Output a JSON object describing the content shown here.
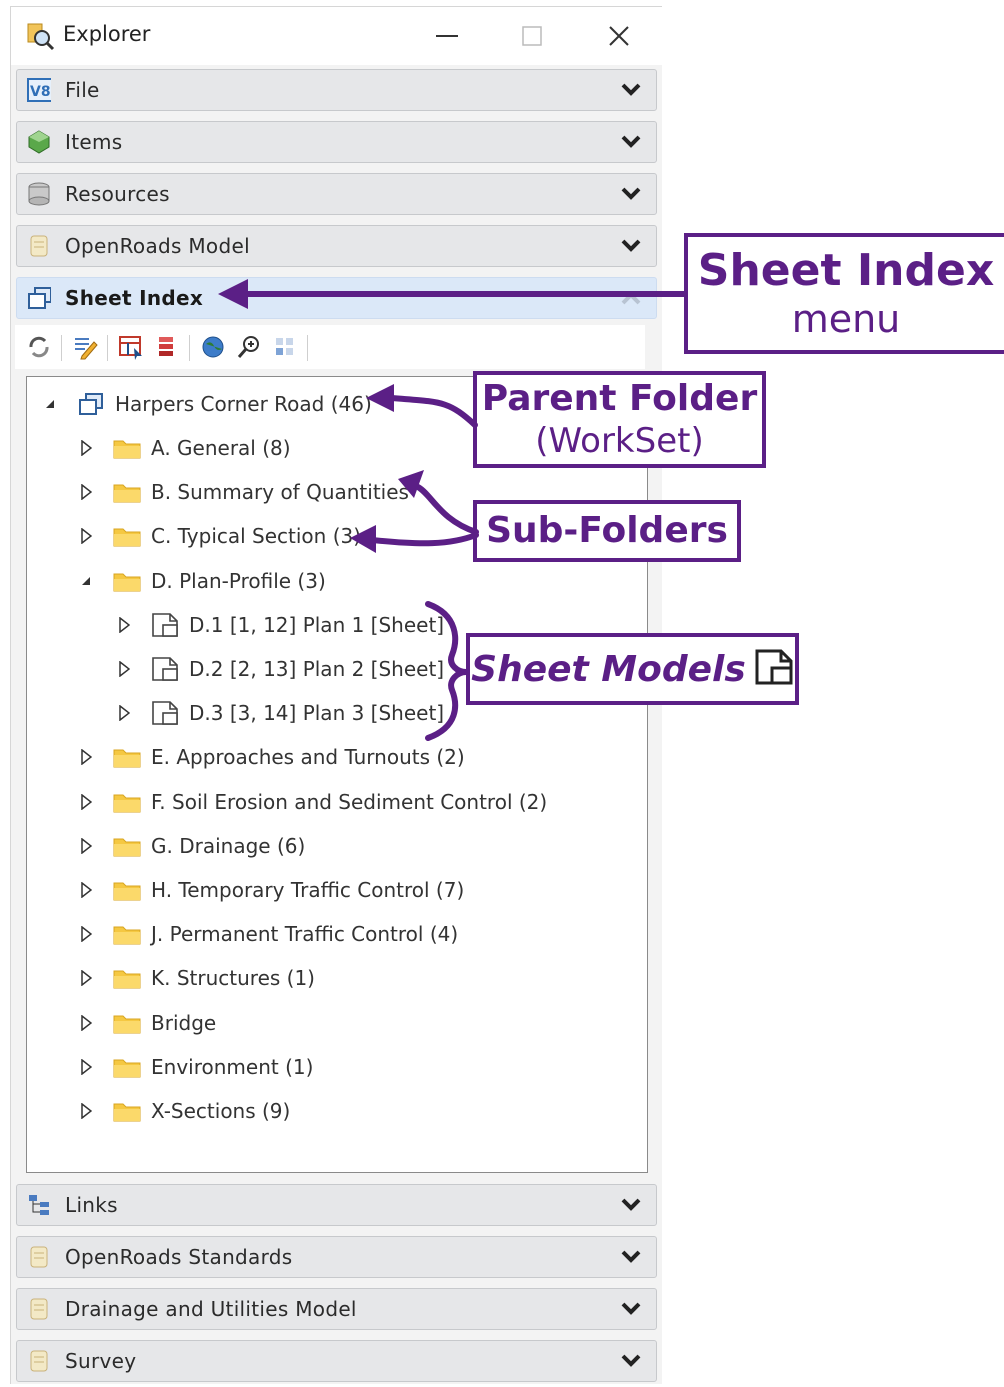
{
  "window": {
    "title": "Explorer",
    "minimize_glyph": "—",
    "maximize_glyph": "☐",
    "close_glyph": "✕"
  },
  "panels_top": [
    {
      "label": "File",
      "icon": "v8-file-icon"
    },
    {
      "label": "Items",
      "icon": "items-cube-icon"
    },
    {
      "label": "Resources",
      "icon": "resources-icon"
    },
    {
      "label": "OpenRoads Model",
      "icon": "document-cylinder-icon"
    }
  ],
  "sheet_index": {
    "label": "Sheet Index",
    "icon": "sheet-index-icon"
  },
  "toolbar": [
    "refresh-icon",
    "edit-properties-icon",
    "table-select-icon",
    "stack-icon",
    "globe-icon",
    "zoom-icon",
    "grid-icon"
  ],
  "tree": {
    "root": {
      "label": "Harpers Corner Road (46)",
      "expanded": true
    },
    "items": [
      {
        "label": "A. General (8)",
        "type": "folder",
        "level": 1,
        "expander": "collapsed"
      },
      {
        "label": "B. Summary of Quantities",
        "type": "folder",
        "level": 1,
        "expander": "collapsed"
      },
      {
        "label": "C. Typical Section (3)",
        "type": "folder",
        "level": 1,
        "expander": "collapsed"
      },
      {
        "label": "D. Plan-Profile (3)",
        "type": "folder",
        "level": 1,
        "expander": "expanded"
      },
      {
        "label": "D.1 [1, 12] Plan 1 [Sheet]",
        "type": "sheet",
        "level": 2,
        "expander": "collapsed"
      },
      {
        "label": "D.2 [2, 13] Plan 2 [Sheet]",
        "type": "sheet",
        "level": 2,
        "expander": "collapsed"
      },
      {
        "label": "D.3 [3, 14] Plan 3 [Sheet]",
        "type": "sheet",
        "level": 2,
        "expander": "collapsed"
      },
      {
        "label": "E. Approaches and Turnouts (2)",
        "type": "folder",
        "level": 1,
        "expander": "collapsed"
      },
      {
        "label": "F. Soil Erosion and Sediment Control (2)",
        "type": "folder",
        "level": 1,
        "expander": "collapsed"
      },
      {
        "label": "G. Drainage (6)",
        "type": "folder",
        "level": 1,
        "expander": "collapsed"
      },
      {
        "label": "H. Temporary Traffic Control (7)",
        "type": "folder",
        "level": 1,
        "expander": "collapsed"
      },
      {
        "label": "J. Permanent Traffic Control (4)",
        "type": "folder",
        "level": 1,
        "expander": "collapsed"
      },
      {
        "label": "K. Structures (1)",
        "type": "folder",
        "level": 1,
        "expander": "collapsed"
      },
      {
        "label": "Bridge",
        "type": "folder",
        "level": 1,
        "expander": "collapsed"
      },
      {
        "label": "Environment (1)",
        "type": "folder",
        "level": 1,
        "expander": "collapsed"
      },
      {
        "label": "X-Sections (9)",
        "type": "folder",
        "level": 1,
        "expander": "collapsed"
      }
    ]
  },
  "panels_bottom": [
    {
      "label": "Links",
      "icon": "links-tree-icon"
    },
    {
      "label": "OpenRoads Standards",
      "icon": "document-cylinder-icon"
    },
    {
      "label": "Drainage and Utilities Model",
      "icon": "document-cylinder-icon"
    },
    {
      "label": "Survey",
      "icon": "document-cylinder-icon"
    }
  ],
  "callouts": {
    "sheet_index_title": "Sheet Index",
    "sheet_index_sub": "menu",
    "parent_folder_title": "Parent Folder",
    "parent_folder_sub": "(WorkSet)",
    "sub_folders": "Sub-Folders",
    "sheet_models": "Sheet Models"
  },
  "colors": {
    "accent_purple": "#5b1f86",
    "active_panel": "#dbe8f8",
    "folder_yellow": "#f5c842"
  }
}
